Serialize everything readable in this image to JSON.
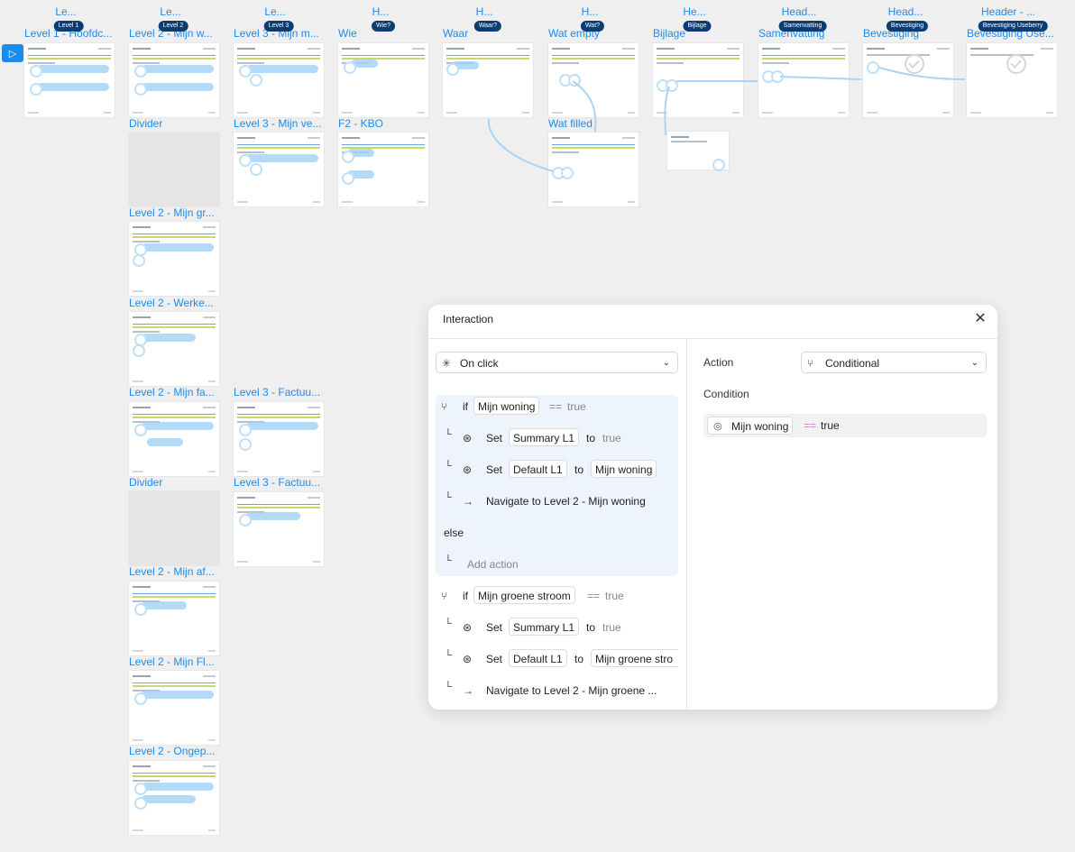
{
  "columns": [
    {
      "head": "Le...",
      "badge": "Level 1",
      "frame": "Level 1 - Hoofdc..."
    },
    {
      "head": "Le...",
      "badge": "Level 2",
      "frame": "Level 2 - Mijn w..."
    },
    {
      "head": "Le...",
      "badge": "Level 3",
      "frame": "Level 3 - Mijn m..."
    },
    {
      "head": "H...",
      "badge": "Wie?",
      "frame": "Wie"
    },
    {
      "head": "H...",
      "badge": "Waar?",
      "frame": "Waar"
    },
    {
      "head": "H...",
      "badge": "Wat?",
      "frame": "Wat empty"
    },
    {
      "head": "He...",
      "badge": "Bijlage",
      "frame": "Bijlage"
    },
    {
      "head": "Head...",
      "badge": "Samenvatting",
      "frame": "Samenvatting"
    },
    {
      "head": "Head...",
      "badge": "Bevestiging",
      "frame": "Bevestiging"
    },
    {
      "head": "Header - ...",
      "badge": "Bevestiging Useberry",
      "frame": "Bevestiging Use..."
    }
  ],
  "frames_extra": [
    {
      "key": "divider1",
      "title": "Divider"
    },
    {
      "key": "l2groen",
      "title": "Level 2 - Mijn gr..."
    },
    {
      "key": "l2werk",
      "title": "Level 2 - Werke..."
    },
    {
      "key": "l2fa",
      "title": "Level 2 - Mijn fa..."
    },
    {
      "key": "divider2",
      "title": "Divider"
    },
    {
      "key": "l2af",
      "title": "Level 2 - Mijn af..."
    },
    {
      "key": "l2fl",
      "title": "Level 2 - Mijn Fl..."
    },
    {
      "key": "l2onge",
      "title": "Level 2 - Ongep..."
    },
    {
      "key": "l3ve",
      "title": "Level 3 - Mijn ve..."
    },
    {
      "key": "l3fa1",
      "title": "Level 3 - Factuu..."
    },
    {
      "key": "l3fa2",
      "title": "Level 3 - Factuu..."
    },
    {
      "key": "f2kbo",
      "title": "F2 - KBO"
    },
    {
      "key": "watfilled",
      "title": "Wat filled"
    }
  ],
  "panel": {
    "title": "Interaction",
    "trigger": "On click",
    "action_label": "Action",
    "action_value": "Conditional",
    "condition_label": "Condition",
    "condition_var": "Mijn woning",
    "condition_op": "==",
    "condition_val": "true",
    "blocks": {
      "if1": {
        "kw": "if",
        "var": "Mijn woning",
        "op": "==",
        "val": "true"
      },
      "set1a": {
        "kw": "Set",
        "var": "Summary L1",
        "to": "to",
        "val": "true"
      },
      "set1b": {
        "kw": "Set",
        "var": "Default L1",
        "to": "to",
        "val": "Mijn woning"
      },
      "nav1": {
        "text": "Navigate to Level 2 - Mijn woning"
      },
      "else": "else",
      "add": "Add action",
      "if2": {
        "kw": "if",
        "var": "Mijn groene stroom",
        "op": "==",
        "val": "true"
      },
      "set2a": {
        "kw": "Set",
        "var": "Summary L1",
        "to": "to",
        "val": "true"
      },
      "set2b": {
        "kw": "Set",
        "var": "Default L1",
        "to": "to",
        "val": "Mijn groene stro"
      },
      "nav2": {
        "text": "Navigate to Level 2 - Mijn groene ..."
      }
    }
  },
  "colors": {
    "canvas": "#efefef",
    "accent": "#1a8cf0",
    "badge": "#0b3d73",
    "wire": "#a8d4f5"
  },
  "icons": {
    "sidebar": "play-frame-icon",
    "close": "close-icon",
    "trigger": "cursor-click-icon",
    "action": "conditional-icon",
    "set": "set-variable-icon",
    "navigate": "arrow-right-icon",
    "toggle": "boolean-variable-icon"
  }
}
